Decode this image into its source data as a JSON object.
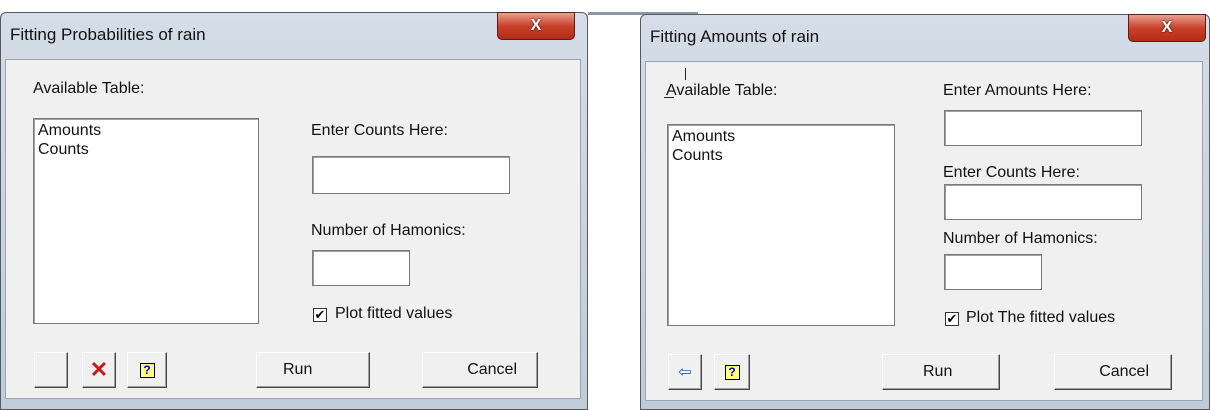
{
  "probabilities_dialog": {
    "title": "Fitting Probabilities of rain",
    "close_glyph": "X",
    "available_table_label": "Available Table:",
    "list_items": [
      "Amounts",
      "Counts"
    ],
    "counts_label": "Enter Counts Here:",
    "counts_value": "",
    "harmonics_label": "Number of Hamonics:",
    "harmonics_value": "",
    "plot_checkbox_label": "Plot fitted values",
    "plot_checked": true,
    "check_mark": "✔",
    "delete_icon": "✕",
    "help_icon": "?",
    "run_label": "Run",
    "cancel_label": "Cancel"
  },
  "amounts_dialog": {
    "title": "Fitting Amounts of rain",
    "close_glyph": "X",
    "available_table_label": "Available Table:",
    "list_items": [
      "Amounts",
      "Counts"
    ],
    "amounts_label": "Enter Amounts Here:",
    "amounts_value": "",
    "counts_label": "Enter Counts Here:",
    "counts_value": "",
    "harmonics_label": "Number of Hamonics:",
    "harmonics_value": "",
    "plot_checkbox_label": "Plot The fitted values",
    "plot_checked": true,
    "check_mark": "✔",
    "transfer_icon": "⇦",
    "help_icon": "?",
    "run_label": "Run",
    "cancel_label": "Cancel"
  },
  "colors": {
    "dialog_face": "#f0f0f0",
    "title_gradient_top": "#d4dde8",
    "close_button_red": "#c9412a"
  }
}
